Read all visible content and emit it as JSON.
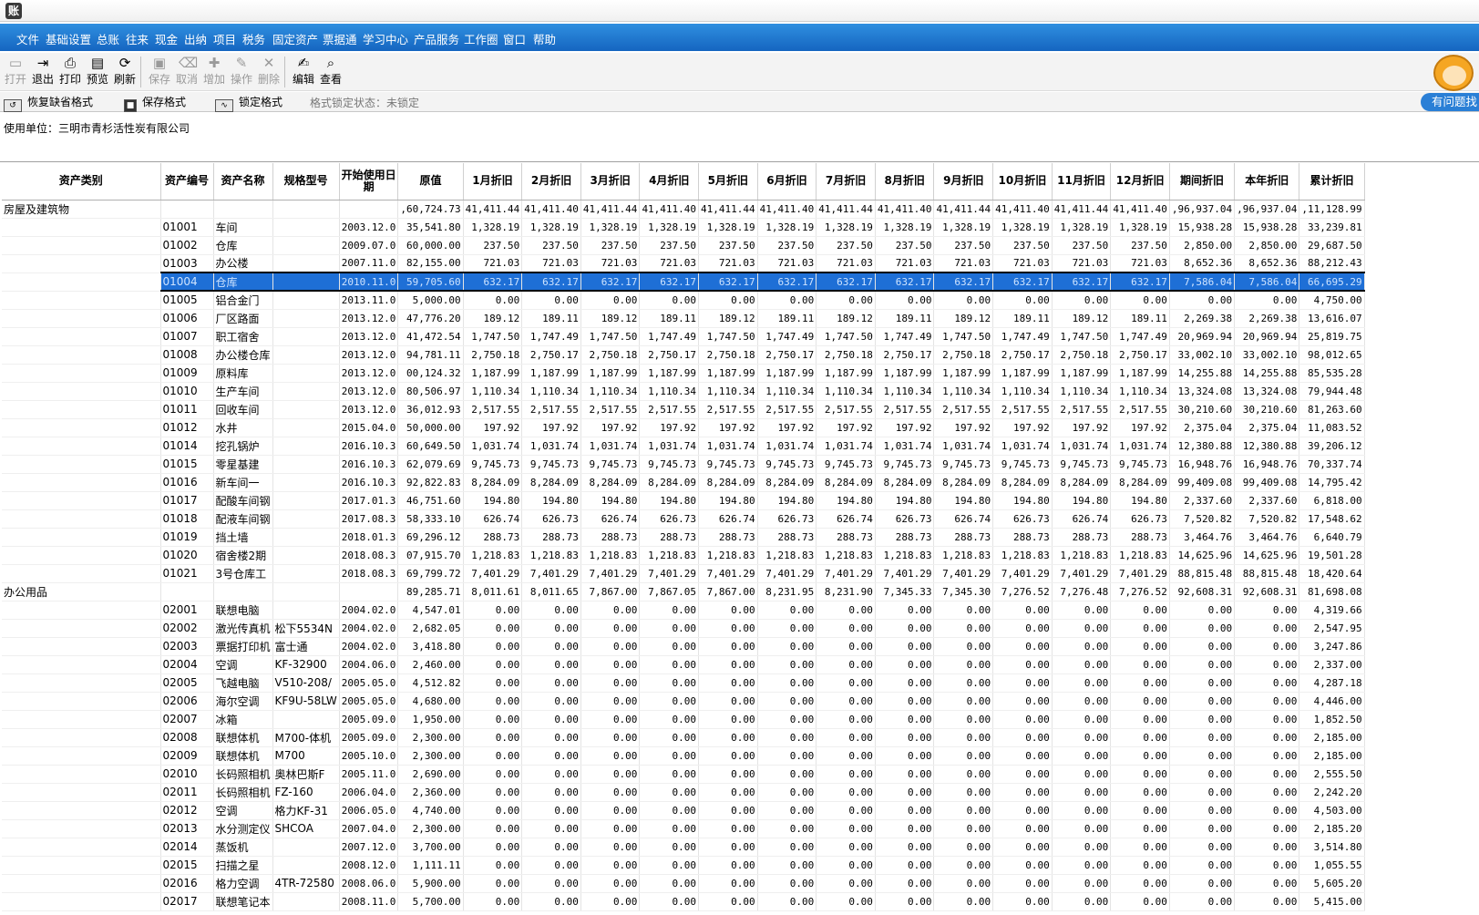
{
  "app": {
    "icon": "app-logo-icon"
  },
  "menu": [
    "文件",
    "基础设置",
    "总账",
    "往来",
    "现金",
    "出纳",
    "项目",
    "税务",
    "固定资产",
    "票据通",
    "学习中心",
    "产品服务",
    "工作圈",
    "窗口",
    "帮助"
  ],
  "toolbar": [
    {
      "label": "打开",
      "icon": "folder-open-icon",
      "enabled": false
    },
    {
      "label": "退出",
      "icon": "exit-icon",
      "enabled": true
    },
    {
      "label": "打印",
      "icon": "printer-icon",
      "enabled": true
    },
    {
      "label": "预览",
      "icon": "preview-icon",
      "enabled": true
    },
    {
      "label": "刷新",
      "icon": "refresh-icon",
      "enabled": true
    },
    {
      "label": "保存",
      "icon": "save-icon",
      "enabled": false
    },
    {
      "label": "取消",
      "icon": "cancel-icon",
      "enabled": false
    },
    {
      "label": "增加",
      "icon": "add-icon",
      "enabled": false
    },
    {
      "label": "操作",
      "icon": "operate-icon",
      "enabled": false
    },
    {
      "label": "删除",
      "icon": "delete-icon",
      "enabled": false
    },
    {
      "label": "编辑",
      "icon": "edit-icon",
      "enabled": true
    },
    {
      "label": "查看",
      "icon": "view-icon",
      "enabled": true
    }
  ],
  "format_bar": {
    "restore_label": "恢复缺省格式",
    "save_label": "保存格式",
    "lock_label": "锁定格式",
    "lock_status": "格式锁定状态：未锁定"
  },
  "helper": {
    "tab_label": "有问题找"
  },
  "unit": {
    "label": "使用单位：三明市青杉活性炭有限公司"
  },
  "table": {
    "columns": [
      "资产类别",
      "资产编号",
      "资产名称",
      "规格型号",
      "开始使用日期",
      "原值",
      "1月折旧",
      "2月折旧",
      "3月折旧",
      "4月折旧",
      "5月折旧",
      "6月折旧",
      "7月折旧",
      "8月折旧",
      "9月折旧",
      "10月折旧",
      "11月折旧",
      "12月折旧",
      "期间折旧",
      "本年折旧",
      "累计折旧"
    ],
    "rows": [
      [
        "房屋及建筑物",
        "",
        "",
        "",
        "",
        ",60,724.73",
        "41,411.44",
        "41,411.40",
        "41,411.44",
        "41,411.40",
        "41,411.44",
        "41,411.40",
        "41,411.44",
        "41,411.40",
        "41,411.44",
        "41,411.40",
        "41,411.44",
        "41,411.40",
        ",96,937.04",
        ",96,937.04",
        ",11,128.99"
      ],
      [
        "",
        "01001",
        "车间",
        "",
        "2003.12.0",
        "35,541.80",
        "1,328.19",
        "1,328.19",
        "1,328.19",
        "1,328.19",
        "1,328.19",
        "1,328.19",
        "1,328.19",
        "1,328.19",
        "1,328.19",
        "1,328.19",
        "1,328.19",
        "1,328.19",
        "15,938.28",
        "15,938.28",
        "33,239.81"
      ],
      [
        "",
        "01002",
        "仓库",
        "",
        "2009.07.0",
        "60,000.00",
        "237.50",
        "237.50",
        "237.50",
        "237.50",
        "237.50",
        "237.50",
        "237.50",
        "237.50",
        "237.50",
        "237.50",
        "237.50",
        "237.50",
        "2,850.00",
        "2,850.00",
        "29,687.50"
      ],
      [
        "",
        "01003",
        "办公楼",
        "",
        "2007.11.0",
        "82,155.00",
        "721.03",
        "721.03",
        "721.03",
        "721.03",
        "721.03",
        "721.03",
        "721.03",
        "721.03",
        "721.03",
        "721.03",
        "721.03",
        "721.03",
        "8,652.36",
        "8,652.36",
        "88,212.43"
      ],
      [
        "",
        "01004",
        "仓库",
        "",
        "2010.11.0",
        "59,705.60",
        "632.17",
        "632.17",
        "632.17",
        "632.17",
        "632.17",
        "632.17",
        "632.17",
        "632.17",
        "632.17",
        "632.17",
        "632.17",
        "632.17",
        "7,586.04",
        "7,586.04",
        "66,695.29"
      ],
      [
        "",
        "01005",
        "铝合金门",
        "",
        "2013.11.0",
        "5,000.00",
        "0.00",
        "0.00",
        "0.00",
        "0.00",
        "0.00",
        "0.00",
        "0.00",
        "0.00",
        "0.00",
        "0.00",
        "0.00",
        "0.00",
        "0.00",
        "0.00",
        "4,750.00"
      ],
      [
        "",
        "01006",
        "厂区路面",
        "",
        "2013.12.0",
        "47,776.20",
        "189.12",
        "189.11",
        "189.12",
        "189.11",
        "189.12",
        "189.11",
        "189.12",
        "189.11",
        "189.12",
        "189.11",
        "189.12",
        "189.11",
        "2,269.38",
        "2,269.38",
        "13,616.07"
      ],
      [
        "",
        "01007",
        "职工宿舍",
        "",
        "2013.12.0",
        "41,472.54",
        "1,747.50",
        "1,747.49",
        "1,747.50",
        "1,747.49",
        "1,747.50",
        "1,747.49",
        "1,747.50",
        "1,747.49",
        "1,747.50",
        "1,747.49",
        "1,747.50",
        "1,747.49",
        "20,969.94",
        "20,969.94",
        "25,819.75"
      ],
      [
        "",
        "01008",
        "办公楼仓库",
        "",
        "2013.12.0",
        "94,781.11",
        "2,750.18",
        "2,750.17",
        "2,750.18",
        "2,750.17",
        "2,750.18",
        "2,750.17",
        "2,750.18",
        "2,750.17",
        "2,750.18",
        "2,750.17",
        "2,750.18",
        "2,750.17",
        "33,002.10",
        "33,002.10",
        "98,012.65"
      ],
      [
        "",
        "01009",
        "原料库",
        "",
        "2013.12.0",
        "00,124.32",
        "1,187.99",
        "1,187.99",
        "1,187.99",
        "1,187.99",
        "1,187.99",
        "1,187.99",
        "1,187.99",
        "1,187.99",
        "1,187.99",
        "1,187.99",
        "1,187.99",
        "1,187.99",
        "14,255.88",
        "14,255.88",
        "85,535.28"
      ],
      [
        "",
        "01010",
        "生产车间",
        "",
        "2013.12.0",
        "80,506.97",
        "1,110.34",
        "1,110.34",
        "1,110.34",
        "1,110.34",
        "1,110.34",
        "1,110.34",
        "1,110.34",
        "1,110.34",
        "1,110.34",
        "1,110.34",
        "1,110.34",
        "1,110.34",
        "13,324.08",
        "13,324.08",
        "79,944.48"
      ],
      [
        "",
        "01011",
        "回收车间",
        "",
        "2013.12.0",
        "36,012.93",
        "2,517.55",
        "2,517.55",
        "2,517.55",
        "2,517.55",
        "2,517.55",
        "2,517.55",
        "2,517.55",
        "2,517.55",
        "2,517.55",
        "2,517.55",
        "2,517.55",
        "2,517.55",
        "30,210.60",
        "30,210.60",
        "81,263.60"
      ],
      [
        "",
        "01012",
        "水井",
        "",
        "2015.04.0",
        "50,000.00",
        "197.92",
        "197.92",
        "197.92",
        "197.92",
        "197.92",
        "197.92",
        "197.92",
        "197.92",
        "197.92",
        "197.92",
        "197.92",
        "197.92",
        "2,375.04",
        "2,375.04",
        "11,083.52"
      ],
      [
        "",
        "01014",
        "挖孔锅炉",
        "",
        "2016.10.3",
        "60,649.50",
        "1,031.74",
        "1,031.74",
        "1,031.74",
        "1,031.74",
        "1,031.74",
        "1,031.74",
        "1,031.74",
        "1,031.74",
        "1,031.74",
        "1,031.74",
        "1,031.74",
        "1,031.74",
        "12,380.88",
        "12,380.88",
        "39,206.12"
      ],
      [
        "",
        "01015",
        "零星基建",
        "",
        "2016.10.3",
        "62,079.69",
        "9,745.73",
        "9,745.73",
        "9,745.73",
        "9,745.73",
        "9,745.73",
        "9,745.73",
        "9,745.73",
        "9,745.73",
        "9,745.73",
        "9,745.73",
        "9,745.73",
        "9,745.73",
        "16,948.76",
        "16,948.76",
        "70,337.74"
      ],
      [
        "",
        "01016",
        "新车间一",
        "",
        "2016.10.3",
        "92,822.83",
        "8,284.09",
        "8,284.09",
        "8,284.09",
        "8,284.09",
        "8,284.09",
        "8,284.09",
        "8,284.09",
        "8,284.09",
        "8,284.09",
        "8,284.09",
        "8,284.09",
        "8,284.09",
        "99,409.08",
        "99,409.08",
        "14,795.42"
      ],
      [
        "",
        "01017",
        "配酸车间钢",
        "",
        "2017.01.3",
        "46,751.60",
        "194.80",
        "194.80",
        "194.80",
        "194.80",
        "194.80",
        "194.80",
        "194.80",
        "194.80",
        "194.80",
        "194.80",
        "194.80",
        "194.80",
        "2,337.60",
        "2,337.60",
        "6,818.00"
      ],
      [
        "",
        "01018",
        "配液车间钢",
        "",
        "2017.08.3",
        "58,333.10",
        "626.74",
        "626.73",
        "626.74",
        "626.73",
        "626.74",
        "626.73",
        "626.74",
        "626.73",
        "626.74",
        "626.73",
        "626.74",
        "626.73",
        "7,520.82",
        "7,520.82",
        "17,548.62"
      ],
      [
        "",
        "01019",
        "挡土墙",
        "",
        "2018.01.3",
        "69,296.12",
        "288.73",
        "288.73",
        "288.73",
        "288.73",
        "288.73",
        "288.73",
        "288.73",
        "288.73",
        "288.73",
        "288.73",
        "288.73",
        "288.73",
        "3,464.76",
        "3,464.76",
        "6,640.79"
      ],
      [
        "",
        "01020",
        "宿舍楼2期",
        "",
        "2018.08.3",
        "07,915.70",
        "1,218.83",
        "1,218.83",
        "1,218.83",
        "1,218.83",
        "1,218.83",
        "1,218.83",
        "1,218.83",
        "1,218.83",
        "1,218.83",
        "1,218.83",
        "1,218.83",
        "1,218.83",
        "14,625.96",
        "14,625.96",
        "19,501.28"
      ],
      [
        "",
        "01021",
        "3号仓库工",
        "",
        "2018.08.3",
        "69,799.72",
        "7,401.29",
        "7,401.29",
        "7,401.29",
        "7,401.29",
        "7,401.29",
        "7,401.29",
        "7,401.29",
        "7,401.29",
        "7,401.29",
        "7,401.29",
        "7,401.29",
        "7,401.29",
        "88,815.48",
        "88,815.48",
        "18,420.64"
      ],
      [
        "办公用品",
        "",
        "",
        "",
        "",
        "89,285.71",
        "8,011.61",
        "8,011.65",
        "7,867.00",
        "7,867.05",
        "7,867.00",
        "8,231.95",
        "8,231.90",
        "7,345.33",
        "7,345.30",
        "7,276.52",
        "7,276.48",
        "7,276.52",
        "92,608.31",
        "92,608.31",
        "81,698.08"
      ],
      [
        "",
        "02001",
        "联想电脑",
        "",
        "2004.02.0",
        "4,547.01",
        "0.00",
        "0.00",
        "0.00",
        "0.00",
        "0.00",
        "0.00",
        "0.00",
        "0.00",
        "0.00",
        "0.00",
        "0.00",
        "0.00",
        "0.00",
        "0.00",
        "4,319.66"
      ],
      [
        "",
        "02002",
        "激光传真机",
        "松下5534N",
        "2004.02.0",
        "2,682.05",
        "0.00",
        "0.00",
        "0.00",
        "0.00",
        "0.00",
        "0.00",
        "0.00",
        "0.00",
        "0.00",
        "0.00",
        "0.00",
        "0.00",
        "0.00",
        "0.00",
        "2,547.95"
      ],
      [
        "",
        "02003",
        "票据打印机",
        "富士通",
        "2004.02.0",
        "3,418.80",
        "0.00",
        "0.00",
        "0.00",
        "0.00",
        "0.00",
        "0.00",
        "0.00",
        "0.00",
        "0.00",
        "0.00",
        "0.00",
        "0.00",
        "0.00",
        "0.00",
        "3,247.86"
      ],
      [
        "",
        "02004",
        "空调",
        "KF-32900",
        "2004.06.0",
        "2,460.00",
        "0.00",
        "0.00",
        "0.00",
        "0.00",
        "0.00",
        "0.00",
        "0.00",
        "0.00",
        "0.00",
        "0.00",
        "0.00",
        "0.00",
        "0.00",
        "0.00",
        "2,337.00"
      ],
      [
        "",
        "02005",
        "飞越电脑",
        "V510-208/",
        "2005.05.0",
        "4,512.82",
        "0.00",
        "0.00",
        "0.00",
        "0.00",
        "0.00",
        "0.00",
        "0.00",
        "0.00",
        "0.00",
        "0.00",
        "0.00",
        "0.00",
        "0.00",
        "0.00",
        "4,287.18"
      ],
      [
        "",
        "02006",
        "海尔空调",
        "KF9U-58LW",
        "2005.05.0",
        "4,680.00",
        "0.00",
        "0.00",
        "0.00",
        "0.00",
        "0.00",
        "0.00",
        "0.00",
        "0.00",
        "0.00",
        "0.00",
        "0.00",
        "0.00",
        "0.00",
        "0.00",
        "4,446.00"
      ],
      [
        "",
        "02007",
        "冰箱",
        "",
        "2005.09.0",
        "1,950.00",
        "0.00",
        "0.00",
        "0.00",
        "0.00",
        "0.00",
        "0.00",
        "0.00",
        "0.00",
        "0.00",
        "0.00",
        "0.00",
        "0.00",
        "0.00",
        "0.00",
        "1,852.50"
      ],
      [
        "",
        "02008",
        "联想体机",
        "M700-体机",
        "2005.09.0",
        "2,300.00",
        "0.00",
        "0.00",
        "0.00",
        "0.00",
        "0.00",
        "0.00",
        "0.00",
        "0.00",
        "0.00",
        "0.00",
        "0.00",
        "0.00",
        "0.00",
        "0.00",
        "2,185.00"
      ],
      [
        "",
        "02009",
        "联想体机",
        "M700",
        "2005.10.0",
        "2,300.00",
        "0.00",
        "0.00",
        "0.00",
        "0.00",
        "0.00",
        "0.00",
        "0.00",
        "0.00",
        "0.00",
        "0.00",
        "0.00",
        "0.00",
        "0.00",
        "0.00",
        "2,185.00"
      ],
      [
        "",
        "02010",
        "长码照相机",
        "奥林巴斯F",
        "2005.11.0",
        "2,690.00",
        "0.00",
        "0.00",
        "0.00",
        "0.00",
        "0.00",
        "0.00",
        "0.00",
        "0.00",
        "0.00",
        "0.00",
        "0.00",
        "0.00",
        "0.00",
        "0.00",
        "2,555.50"
      ],
      [
        "",
        "02011",
        "长码照相机",
        "FZ-160",
        "2006.04.0",
        "2,360.00",
        "0.00",
        "0.00",
        "0.00",
        "0.00",
        "0.00",
        "0.00",
        "0.00",
        "0.00",
        "0.00",
        "0.00",
        "0.00",
        "0.00",
        "0.00",
        "0.00",
        "2,242.20"
      ],
      [
        "",
        "02012",
        "空调",
        "格力KF-31",
        "2006.05.0",
        "4,740.00",
        "0.00",
        "0.00",
        "0.00",
        "0.00",
        "0.00",
        "0.00",
        "0.00",
        "0.00",
        "0.00",
        "0.00",
        "0.00",
        "0.00",
        "0.00",
        "0.00",
        "4,503.00"
      ],
      [
        "",
        "02013",
        "水分测定仪",
        "SHCOA",
        "2007.04.0",
        "2,300.00",
        "0.00",
        "0.00",
        "0.00",
        "0.00",
        "0.00",
        "0.00",
        "0.00",
        "0.00",
        "0.00",
        "0.00",
        "0.00",
        "0.00",
        "0.00",
        "0.00",
        "2,185.20"
      ],
      [
        "",
        "02014",
        "蒸饭机",
        "",
        "2007.12.0",
        "3,700.00",
        "0.00",
        "0.00",
        "0.00",
        "0.00",
        "0.00",
        "0.00",
        "0.00",
        "0.00",
        "0.00",
        "0.00",
        "0.00",
        "0.00",
        "0.00",
        "0.00",
        "3,514.80"
      ],
      [
        "",
        "02015",
        "扫描之星",
        "",
        "2008.12.0",
        "1,111.11",
        "0.00",
        "0.00",
        "0.00",
        "0.00",
        "0.00",
        "0.00",
        "0.00",
        "0.00",
        "0.00",
        "0.00",
        "0.00",
        "0.00",
        "0.00",
        "0.00",
        "1,055.55"
      ],
      [
        "",
        "02016",
        "格力空调",
        "4TR-72580",
        "2008.06.0",
        "5,900.00",
        "0.00",
        "0.00",
        "0.00",
        "0.00",
        "0.00",
        "0.00",
        "0.00",
        "0.00",
        "0.00",
        "0.00",
        "0.00",
        "0.00",
        "0.00",
        "0.00",
        "5,605.20"
      ],
      [
        "",
        "02017",
        "联想笔记本",
        "",
        "2008.11.0",
        "5,700.00",
        "0.00",
        "0.00",
        "0.00",
        "0.00",
        "0.00",
        "0.00",
        "0.00",
        "0.00",
        "0.00",
        "0.00",
        "0.00",
        "0.00",
        "0.00",
        "0.00",
        "5,415.00"
      ]
    ],
    "selected_index": 4
  },
  "colors": {
    "menubar": "#1d74cf",
    "selection": "#1e6fd6",
    "help_tab": "#2a7fd6"
  }
}
